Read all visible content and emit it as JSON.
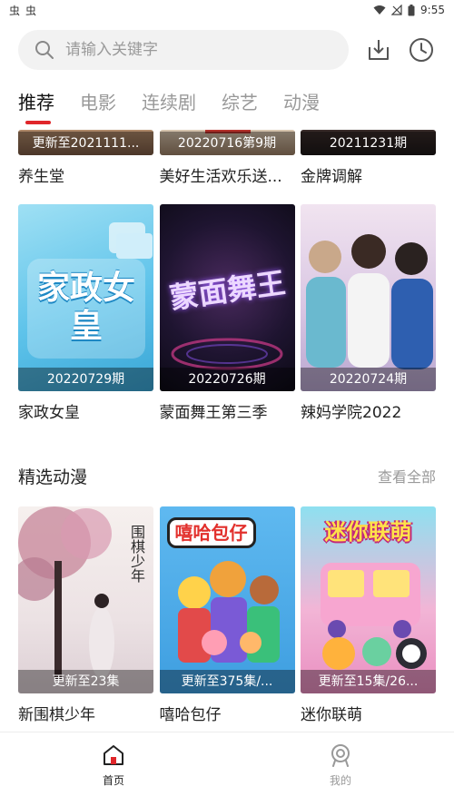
{
  "status_bar": {
    "left_icons": [
      "虫",
      "虫"
    ],
    "time": "9:55"
  },
  "search": {
    "placeholder": "请输入关键字"
  },
  "tabs": [
    {
      "label": "推荐"
    },
    {
      "label": "电影"
    },
    {
      "label": "连续剧"
    },
    {
      "label": "综艺"
    },
    {
      "label": "动漫"
    }
  ],
  "row1": [
    {
      "badge": "更新至2021111...",
      "title": "养生堂"
    },
    {
      "badge": "20220716第9期",
      "title": "美好生活欢乐送..."
    },
    {
      "badge": "20211231期",
      "title": "金牌调解"
    }
  ],
  "row2": [
    {
      "badge": "20220729期",
      "title": "家政女皇",
      "poster_text": "家政女皇"
    },
    {
      "badge": "20220726期",
      "title": "蒙面舞王第三季",
      "poster_text": "蒙面舞王"
    },
    {
      "badge": "20220724期",
      "title": "辣妈学院2022",
      "poster_text": ""
    }
  ],
  "anime_section": {
    "title": "精选动漫",
    "more": "查看全部"
  },
  "row3": [
    {
      "badge": "更新至23集",
      "title": "新围棋少年",
      "poster_text": "围棋少年"
    },
    {
      "badge": "更新至375集/...",
      "title": "嘻哈包仔",
      "poster_text": "嘻哈包仔"
    },
    {
      "badge": "更新至15集/26...",
      "title": "迷你联萌",
      "poster_text": "迷你联萌"
    }
  ],
  "bottom_nav": {
    "home_label": "首页",
    "mine_label": "我的"
  },
  "colors": {
    "accent": "#e0262a",
    "inactive_text": "#999999"
  }
}
